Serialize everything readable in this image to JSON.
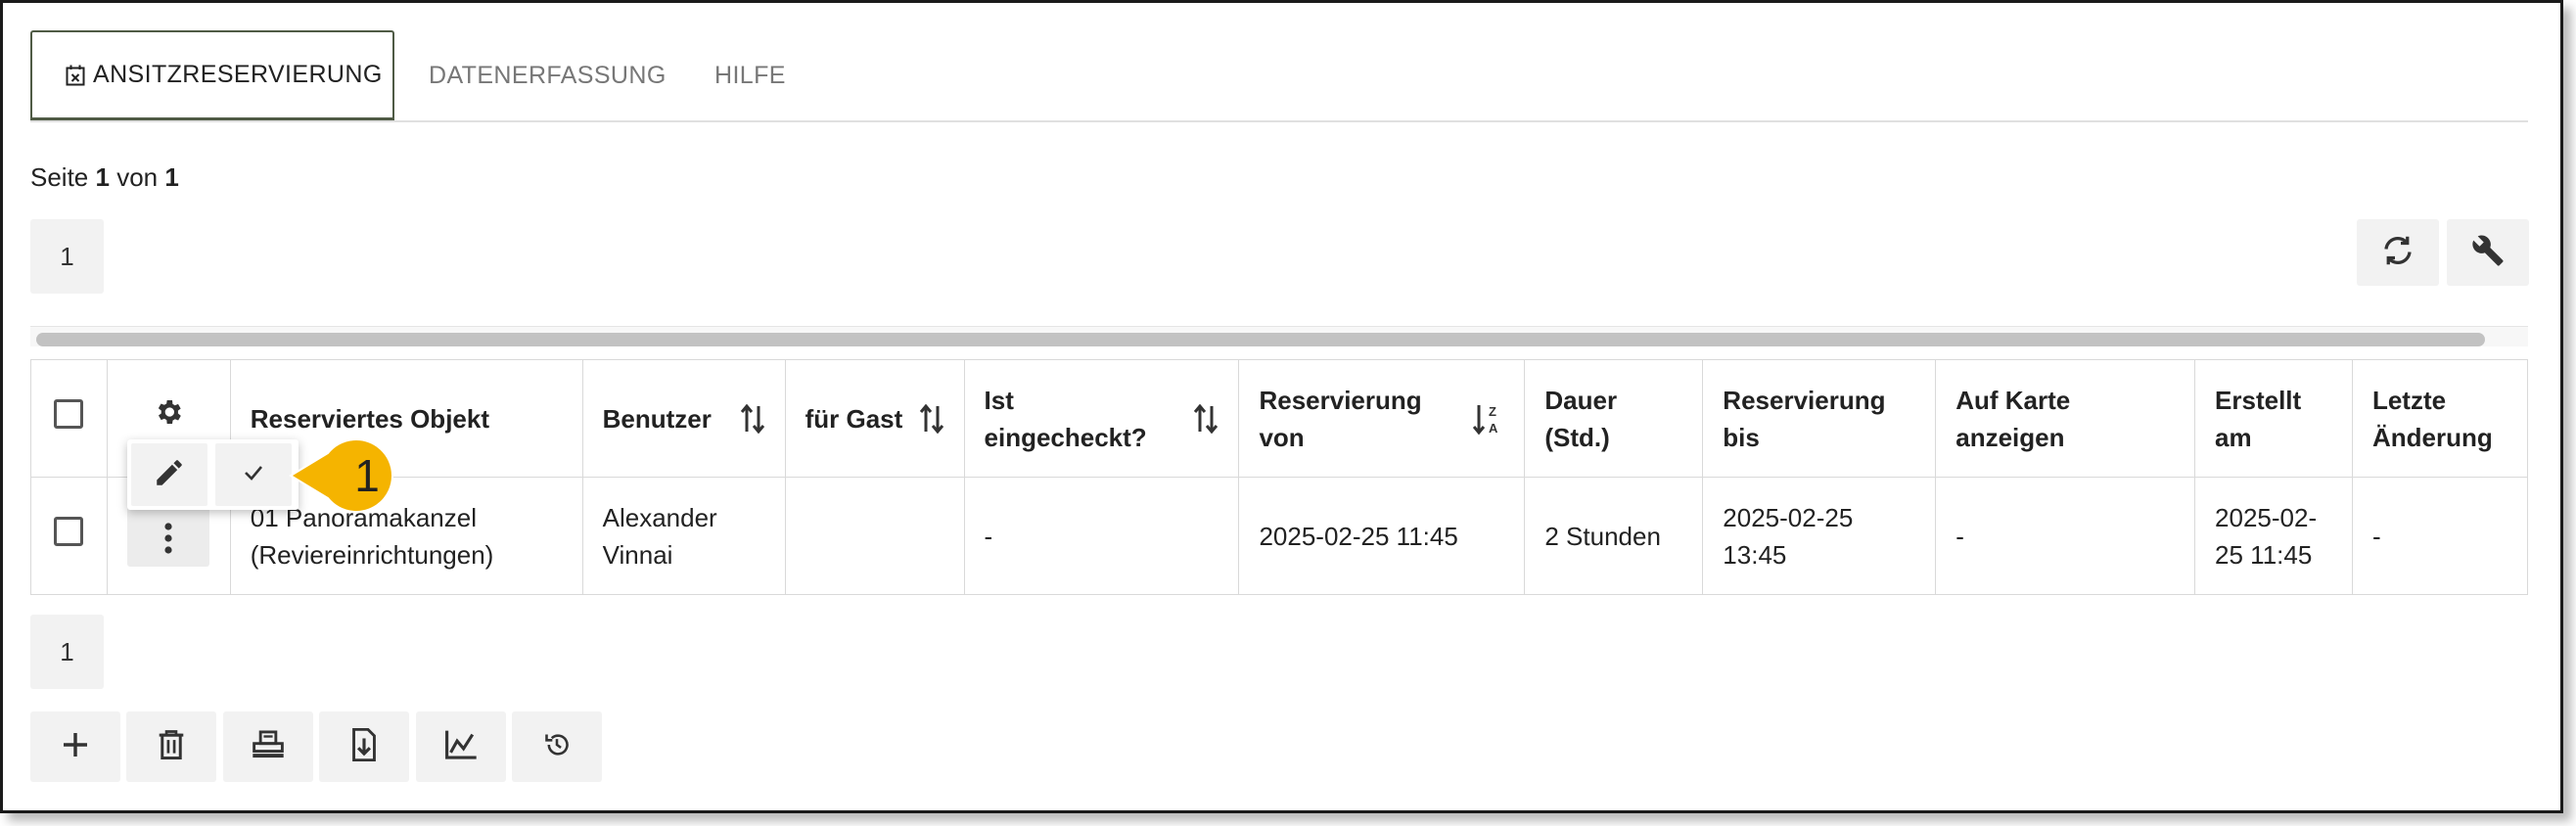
{
  "tabs": [
    {
      "label": "ANSITZRESERVIERUNG",
      "icon": "calendar-x-icon",
      "active": true
    },
    {
      "label": "DATENERFASSUNG",
      "active": false
    },
    {
      "label": "HILFE",
      "active": false
    }
  ],
  "pagination": {
    "prefix": "Seite",
    "current": "1",
    "separator": "von",
    "total": "1",
    "page_button_top": "1",
    "page_button_bottom": "1"
  },
  "table": {
    "columns": [
      {
        "label": "Reserviertes Objekt"
      },
      {
        "label": "Benutzer",
        "sort": "sort-arrows-icon"
      },
      {
        "label": "für Gast",
        "sort": "sort-arrows-icon"
      },
      {
        "label": "Ist eingecheckt?",
        "sort": "sort-arrows-icon"
      },
      {
        "label": "Reservierung von",
        "sort": "sort-z-a-icon"
      },
      {
        "label": "Dauer (Std.)"
      },
      {
        "label": "Reservierung bis"
      },
      {
        "label": "Auf Karte anzeigen"
      },
      {
        "label": "Erstellt am"
      },
      {
        "label": "Letzte Änderung"
      }
    ],
    "rows": [
      {
        "objekt": "01 Panoramakanzel (Reviereinrichtungen)",
        "benutzer": "Alexander Vinnai",
        "gast": "",
        "eingecheckt": "-",
        "von": "2025-02-25 11:45",
        "dauer": "2 Stunden",
        "bis": "2025-02-25 13:45",
        "karte": "-",
        "erstellt": "2025-02-25 11:45",
        "aenderung": "-"
      }
    ]
  },
  "callout": {
    "number": "1",
    "color": "#f5b400"
  },
  "colors": {
    "tab_border": "#4f5b45",
    "button_bg": "#f2f2f2"
  },
  "toolbar_top": [
    "refresh-icon",
    "wrench-icon"
  ],
  "toolbar_bottom": [
    "plus-icon",
    "trash-icon",
    "print-icon",
    "import-icon",
    "chart-icon",
    "history-icon"
  ]
}
